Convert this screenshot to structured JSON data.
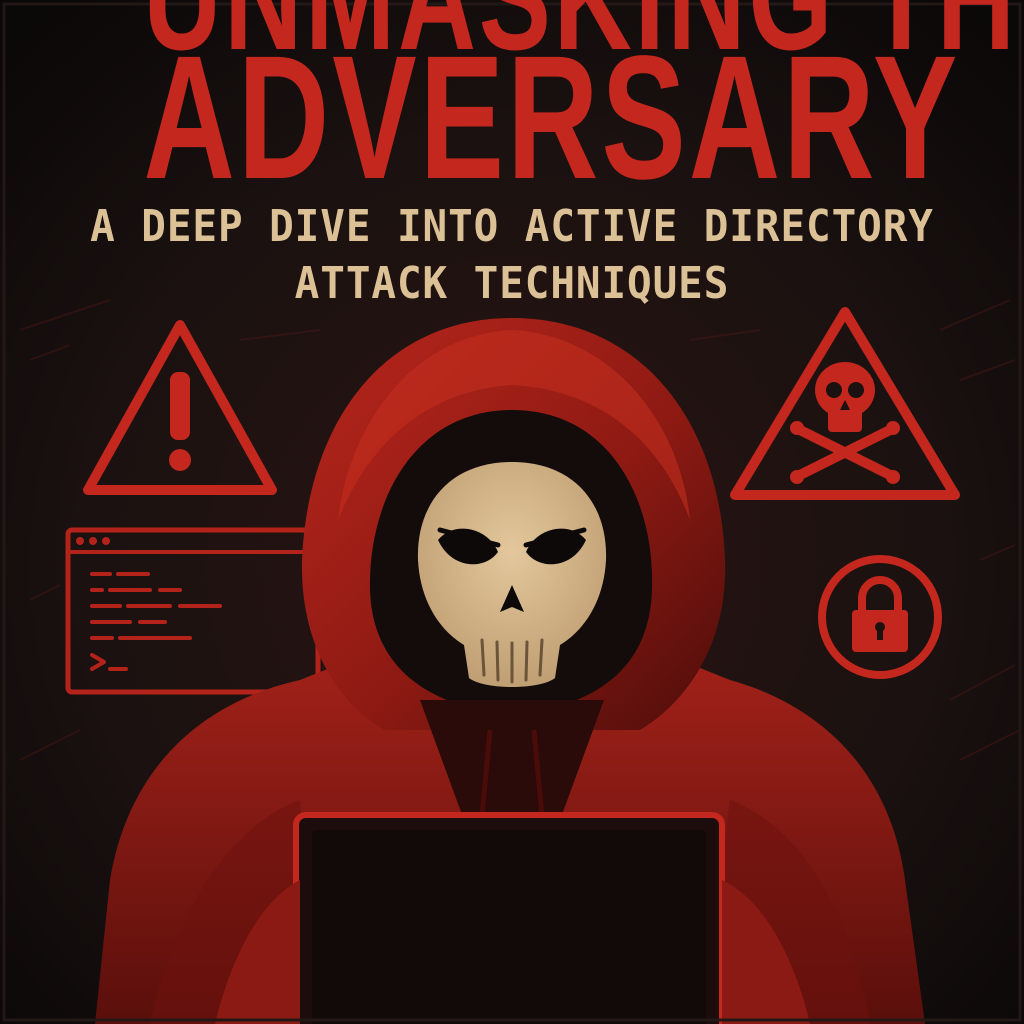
{
  "cover": {
    "title_top": "UNMASKING THE",
    "title_main": "ADVERSARY",
    "subtitle_line1": "A DEEP DIVE INTO ACTIVE DIRECTORY",
    "subtitle_line2": "ATTACK TECHNIQUES"
  },
  "colors": {
    "background": "#151110",
    "accent_red": "#c4271d",
    "hood_dark": "#6e1410",
    "skull": "#d8b98e",
    "subtitle": "#dcc196"
  },
  "icons": [
    "warning-triangle-icon",
    "skull-crossbones-triangle-icon",
    "terminal-window-icon",
    "padlock-circle-icon",
    "laptop-icon",
    "hooded-skull-figure"
  ]
}
